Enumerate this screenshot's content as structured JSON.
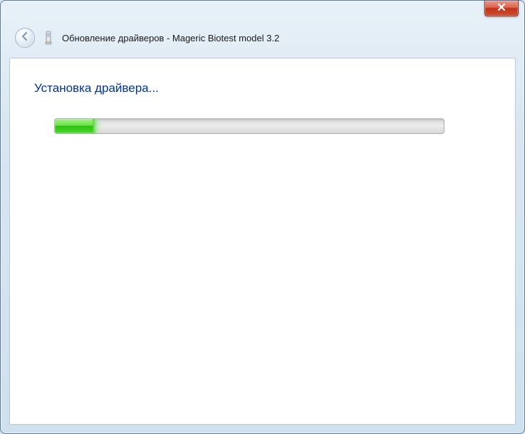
{
  "window": {
    "title": "Обновление драйверов - Mageric Biotest model 3.2"
  },
  "content": {
    "heading": "Установка драйвера..."
  },
  "progress": {
    "percent": 10
  }
}
